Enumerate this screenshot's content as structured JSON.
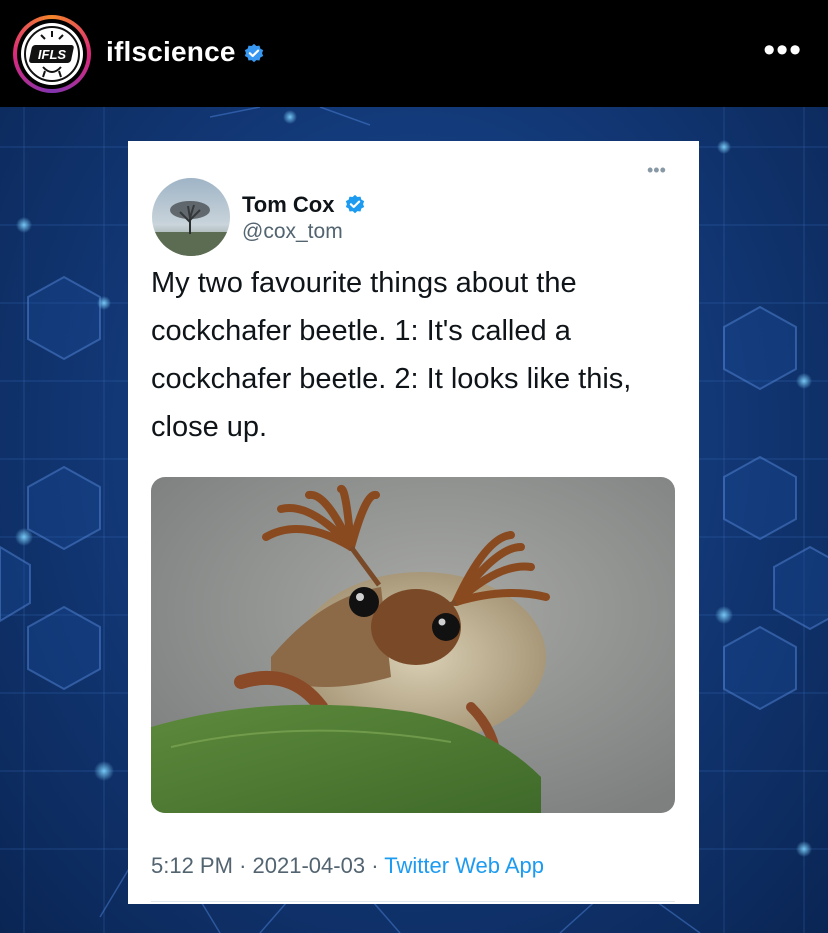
{
  "post_header": {
    "username": "iflscience",
    "avatar_label": "IFLS",
    "more_label": "•••"
  },
  "tweet": {
    "display_name": "Tom Cox",
    "handle": "@cox_tom",
    "more_label": "•••",
    "text": "My two favourite things about the cockchafer beetle. 1: It's called a cockchafer beetle. 2: It looks like this, close up.",
    "time": "5:12 PM",
    "date": "2021-04-03",
    "separator": "·",
    "app": "Twitter Web App"
  },
  "colors": {
    "verified_blue": "#3897f0",
    "twitter_blue": "#1d9bf0",
    "post_background": "#133a7a"
  }
}
